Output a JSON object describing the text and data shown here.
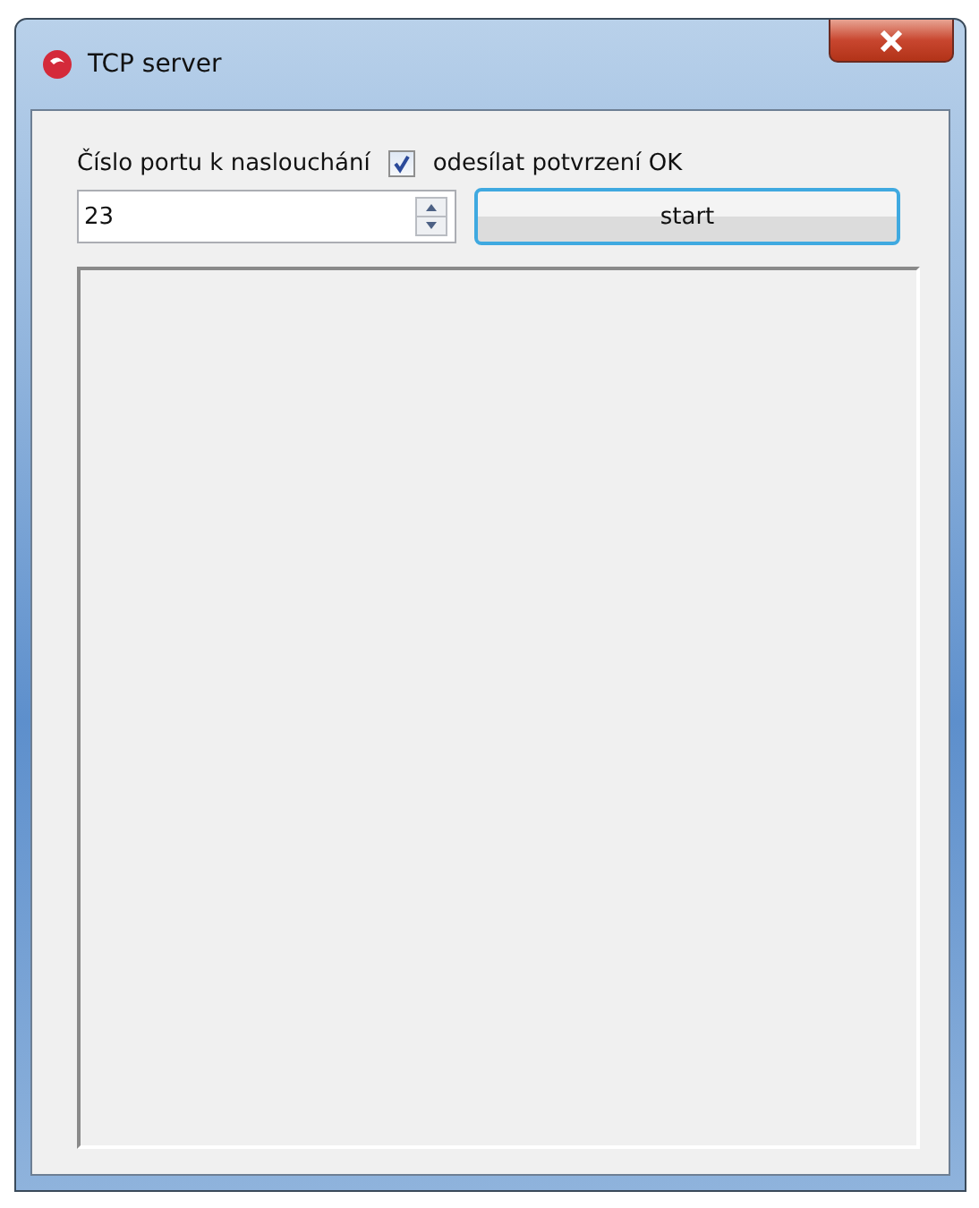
{
  "window": {
    "title": "TCP server"
  },
  "port_label": "Číslo portu k naslouchání",
  "confirm_checkbox": {
    "label": "odesílat potvrzení OK",
    "checked": true
  },
  "port_field": {
    "value": "23"
  },
  "start_button": {
    "label": "start"
  }
}
